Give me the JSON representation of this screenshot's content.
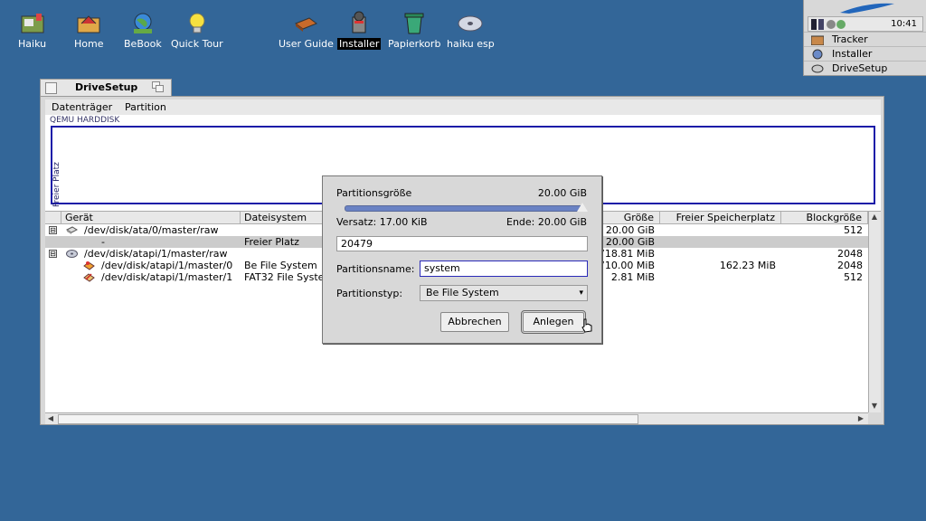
{
  "desktop": {
    "icons": [
      {
        "label": "Haiku"
      },
      {
        "label": "Home"
      },
      {
        "label": "BeBook"
      },
      {
        "label": "Quick Tour"
      },
      {
        "label": "User Guide"
      },
      {
        "label": "Installer"
      },
      {
        "label": "Papierkorb"
      },
      {
        "label": "haiku esp"
      }
    ]
  },
  "deskbar": {
    "clock": "10:41",
    "items": [
      {
        "label": "Tracker"
      },
      {
        "label": "Installer"
      },
      {
        "label": "DriveSetup"
      }
    ]
  },
  "window": {
    "title": "DriveSetup",
    "menu": [
      "Datenträger",
      "Partition"
    ],
    "disk_label": "QEMU HARDDISK",
    "partition_label": "Freier Platz",
    "columns": [
      "Gerät",
      "Dateisystem",
      "Größe",
      "Freier Speicherplatz",
      "Blockgröße"
    ],
    "rows": [
      {
        "expander": "⊟",
        "device": "/dev/disk/ata/0/master/raw",
        "fs": "",
        "size": "20.00 GiB",
        "free": "",
        "block": "512"
      },
      {
        "expander": "",
        "device": "-",
        "fs": "Freier Platz",
        "size": "20.00 GiB",
        "free": "",
        "block": ""
      },
      {
        "expander": "⊟",
        "device": "/dev/disk/atapi/1/master/raw",
        "fs": "",
        "size": "718.81 MiB",
        "free": "",
        "block": "2048"
      },
      {
        "expander": "",
        "device": "/dev/disk/atapi/1/master/0",
        "fs": "Be File System",
        "size": "710.00 MiB",
        "free": "162.23 MiB",
        "block": "2048"
      },
      {
        "expander": "",
        "device": "/dev/disk/atapi/1/master/1",
        "fs": "FAT32 File Syste",
        "size": "2.81 MiB",
        "free": "",
        "block": "512"
      }
    ]
  },
  "dialog": {
    "size_label": "Partitionsgröße",
    "size_value": "20.00 GiB",
    "slider_fraction": 1.0,
    "offset": "Versatz: 17.00 KiB",
    "end": "Ende: 20.00 GiB",
    "size_input": "20479",
    "name_label": "Partitionsname:",
    "name_value": "system",
    "type_label": "Partitionstyp:",
    "type_value": "Be File System",
    "cancel_label": "Abbrechen",
    "create_label": "Anlegen"
  }
}
